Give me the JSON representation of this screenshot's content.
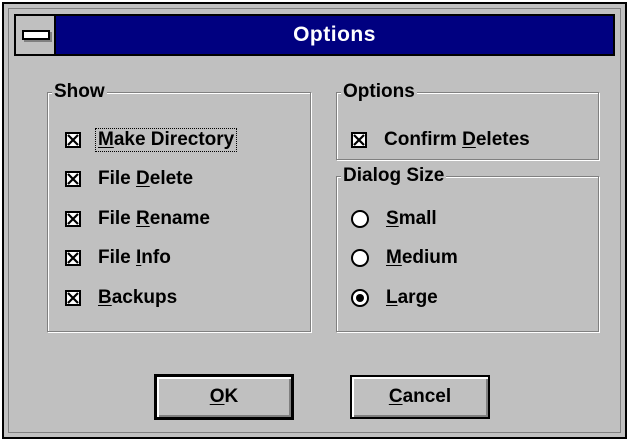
{
  "window": {
    "title": "Options"
  },
  "show_group": {
    "title": "Show",
    "items": [
      {
        "pre": "",
        "key": "M",
        "post": "ake Directory",
        "checked": true,
        "focused": true
      },
      {
        "pre": "File ",
        "key": "D",
        "post": "elete",
        "checked": true
      },
      {
        "pre": "File ",
        "key": "R",
        "post": "ename",
        "checked": true
      },
      {
        "pre": "File ",
        "key": "I",
        "post": "nfo",
        "checked": true
      },
      {
        "pre": "",
        "key": "B",
        "post": "ackups",
        "checked": true
      }
    ]
  },
  "options_group": {
    "title": "Options",
    "confirm_deletes": {
      "pre": "Confirm ",
      "key": "D",
      "post": "eletes",
      "checked": true
    }
  },
  "size_group": {
    "title": "Dialog Size",
    "items": [
      {
        "pre": "",
        "key": "S",
        "post": "mall",
        "selected": false
      },
      {
        "pre": "",
        "key": "M",
        "post": "edium",
        "selected": false
      },
      {
        "pre": "",
        "key": "L",
        "post": "arge",
        "selected": true
      }
    ]
  },
  "buttons": {
    "ok": {
      "pre": "",
      "key": "O",
      "post": "K"
    },
    "cancel": {
      "pre": "",
      "key": "C",
      "post": "ancel"
    }
  }
}
